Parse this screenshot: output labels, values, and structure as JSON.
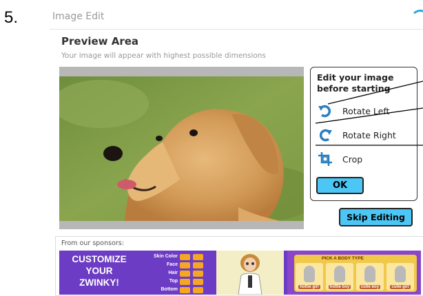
{
  "step_number": "5.",
  "dialog": {
    "title": "Image Edit"
  },
  "preview": {
    "heading": "Preview Area",
    "subtext": "Your image will appear with highest possible dimensions"
  },
  "edit_panel": {
    "heading_line1": "Edit your image",
    "heading_line2": "before starting",
    "tools": [
      {
        "label": "Rotate Left",
        "icon": "rotate-left-icon"
      },
      {
        "label": "Rotate Right",
        "icon": "rotate-right-icon"
      },
      {
        "label": "Crop",
        "icon": "crop-icon"
      }
    ],
    "ok_label": "OK"
  },
  "skip_label": "Skip Editing",
  "sponsors": {
    "label": "From our sponsors:",
    "ad": {
      "headline": [
        "CUSTOMIZE",
        "YOUR",
        "ZWINKY!"
      ],
      "attributes": [
        "Skin Color",
        "Face",
        "Hair",
        "Top",
        "Bottom"
      ],
      "body_type_header": "PICK A BODY TYPE",
      "body_types": [
        "hottie girl",
        "hottie boy",
        "cutie boy",
        "cutie girl"
      ]
    }
  },
  "colors": {
    "accent_button": "#4cc6f4",
    "icon_blue": "#2a7fc0",
    "ad_purple": "#6d3cc4"
  }
}
